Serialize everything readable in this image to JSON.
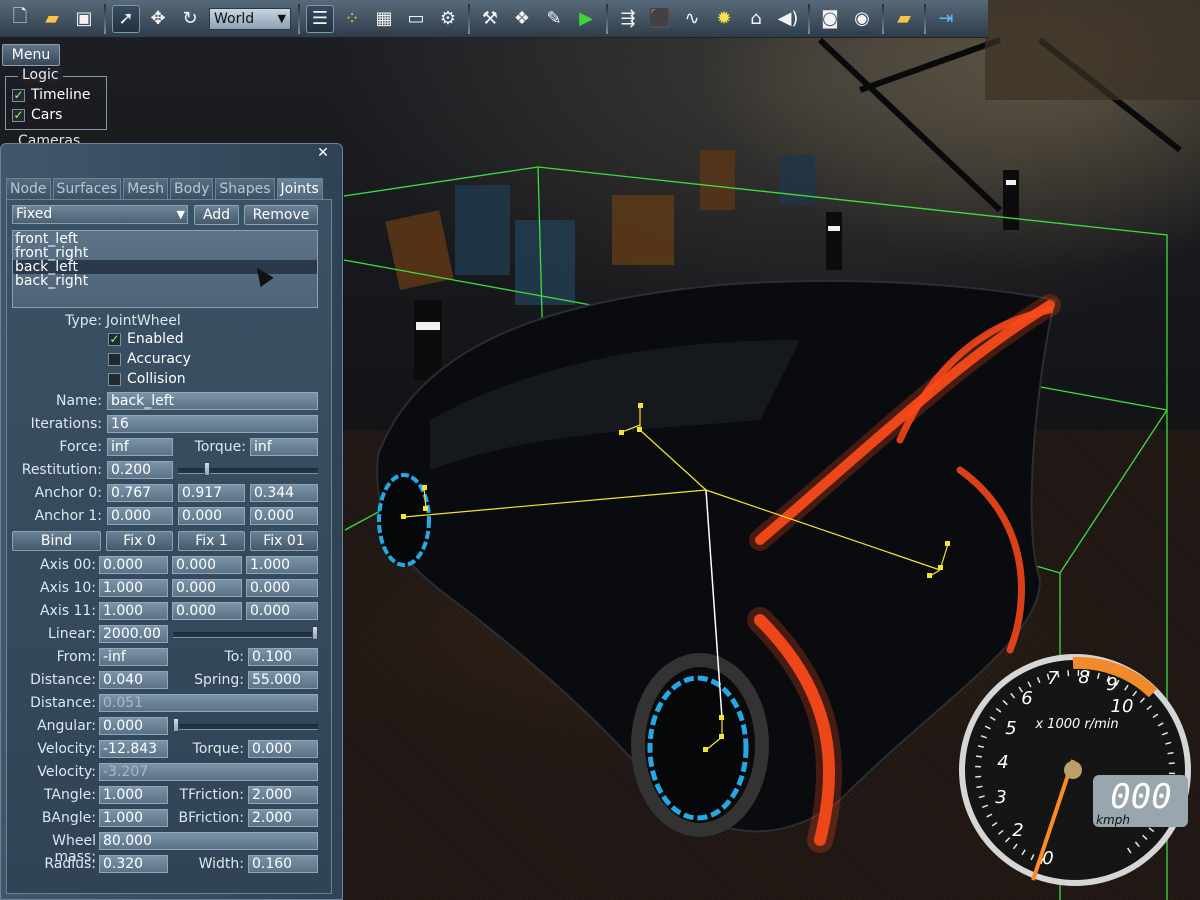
{
  "toolbar": {
    "icons": [
      "new-file-icon",
      "open-folder-icon",
      "save-icon",
      "select-arrow-icon",
      "move-icon",
      "rotate-icon"
    ],
    "coord_space": "World",
    "icons_right": [
      "outline-icon",
      "nodes-icon",
      "grid-icon",
      "monitor-icon",
      "settings-icon",
      "tools-icon",
      "cubes-icon",
      "edit-icon",
      "play-icon",
      "import-icon",
      "box-icon",
      "wave-icon",
      "light-icon",
      "house-icon",
      "sound-icon",
      "camera-icon",
      "screenshot-icon",
      "folder-icon",
      "exit-icon"
    ]
  },
  "menu": {
    "label": "Menu"
  },
  "logic": {
    "title": "Logic",
    "items": [
      {
        "label": "Timeline",
        "checked": true
      },
      {
        "label": "Cars",
        "checked": true
      }
    ]
  },
  "cameras_label": "Cameras",
  "panel": {
    "tabs": [
      "Node",
      "Surfaces",
      "Mesh",
      "Body",
      "Shapes",
      "Joints"
    ],
    "active_tab": "Joints",
    "joint_type_select": "Fixed",
    "add_label": "Add",
    "remove_label": "Remove",
    "joints": [
      "front_left",
      "front_right",
      "back_left",
      "back_right"
    ],
    "selected_joint": "back_left",
    "type_label": "Type:",
    "type_value": "JointWheel",
    "enabled_label": "Enabled",
    "accuracy_label": "Accuracy",
    "collision_label": "Collision",
    "name_label": "Name:",
    "name_value": "back_left",
    "iterations_label": "Iterations:",
    "iterations_value": "16",
    "force_label": "Force:",
    "force_value": "inf",
    "torque_label": "Torque:",
    "torque_value": "inf",
    "restitution_label": "Restitution:",
    "restitution_value": "0.200",
    "anchor0_label": "Anchor 0:",
    "anchor0": [
      "0.767",
      "0.917",
      "0.344"
    ],
    "anchor1_label": "Anchor 1:",
    "anchor1": [
      "0.000",
      "0.000",
      "0.000"
    ],
    "bind_label": "Bind",
    "fix0_label": "Fix 0",
    "fix1_label": "Fix 1",
    "fix01_label": "Fix 01",
    "axis00_label": "Axis 00:",
    "axis00": [
      "0.000",
      "0.000",
      "1.000"
    ],
    "axis10_label": "Axis 10:",
    "axis10": [
      "1.000",
      "0.000",
      "0.000"
    ],
    "axis11_label": "Axis 11:",
    "axis11": [
      "1.000",
      "0.000",
      "0.000"
    ],
    "linear_label": "Linear:",
    "linear_value": "2000.00",
    "from_label": "From:",
    "from_value": "-inf",
    "to_label": "To:",
    "to_value": "0.100",
    "distance_label": "Distance:",
    "distance_value": "0.040",
    "spring_label": "Spring:",
    "spring_value": "55.000",
    "distance2_label": "Distance:",
    "distance2_value": "0.051",
    "angular_label": "Angular:",
    "angular_value": "0.000",
    "velocity_label": "Velocity:",
    "velocity_value": "-12.843",
    "torque2_label": "Torque:",
    "torque2_value": "0.000",
    "velocity2_label": "Velocity:",
    "velocity2_value": "-3.207",
    "tangle_label": "TAngle:",
    "tangle_value": "1.000",
    "tfriction_label": "TFriction:",
    "tfriction_value": "2.000",
    "bangle_label": "BAngle:",
    "bangle_value": "1.000",
    "bfriction_label": "BFriction:",
    "bfriction_value": "2.000",
    "wheelmass_label": "Wheel mass:",
    "wheelmass_value": "80.000",
    "radius_label": "Radius:",
    "radius_value": "0.320",
    "width_label": "Width:",
    "width_value": "0.160"
  },
  "gauge": {
    "unit_rpm": "x 1000 r/min",
    "ticks": [
      "0",
      "2",
      "3",
      "4",
      "5",
      "6",
      "7",
      "8",
      "9",
      "10"
    ],
    "speed": "000",
    "speed_unit": "kmph",
    "colors": {
      "needle": "#ff8a1e",
      "redline": "#f08a2a",
      "face": "#1a1a1a"
    }
  }
}
